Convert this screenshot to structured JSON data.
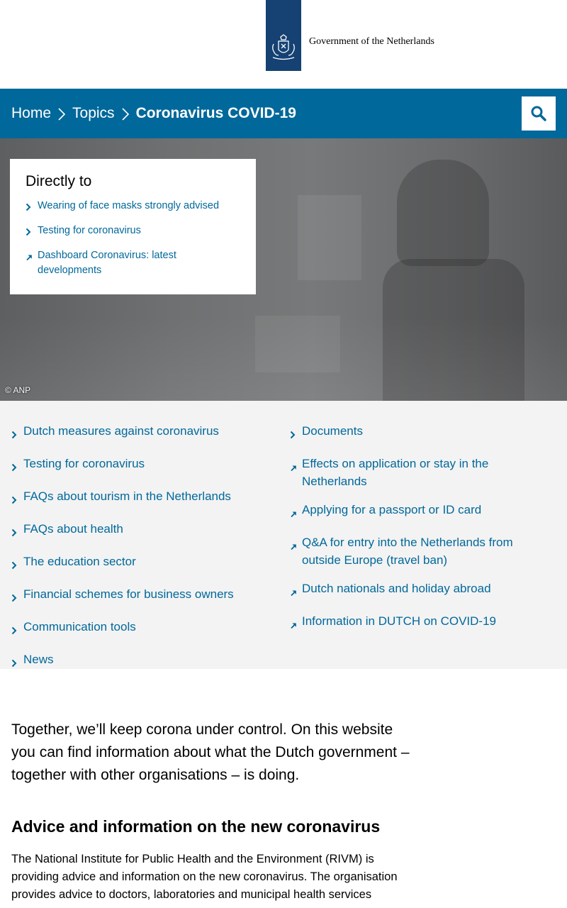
{
  "header": {
    "logo_text": "Government of the Netherlands"
  },
  "breadcrumb": {
    "items": [
      "Home",
      "Topics",
      "Coronavirus COVID-19"
    ]
  },
  "hero": {
    "credit": "© ANP",
    "directly_to": {
      "title": "Directly to",
      "links": [
        {
          "label": "Wearing of face masks strongly advised",
          "icon": "chevron-right-icon"
        },
        {
          "label": "Testing for coronavirus",
          "icon": "chevron-right-icon"
        },
        {
          "label": "Dashboard Coronavirus: latest developments",
          "icon": "external-link-icon"
        }
      ]
    }
  },
  "links": {
    "left": [
      "Dutch measures against coronavirus",
      "Testing for coronavirus",
      "FAQs about tourism in the Netherlands",
      "FAQs about health",
      "The education sector",
      "Financial schemes for business owners",
      "Communication tools",
      "News"
    ],
    "right": [
      {
        "label": "Documents",
        "icon": "chevron-right-icon"
      },
      {
        "label": "Effects on application or stay in the Netherlands",
        "icon": "external-link-icon"
      },
      {
        "label": "Applying for a passport or ID card",
        "icon": "external-link-icon"
      },
      {
        "label": "Q&A for entry into the Netherlands from outside Europe (travel ban)",
        "icon": "external-link-icon"
      },
      {
        "label": "Dutch nationals and holiday abroad",
        "icon": "external-link-icon"
      },
      {
        "label": "Information in DUTCH on COVID-19",
        "icon": "external-link-icon"
      }
    ]
  },
  "content": {
    "intro": "Together, we’ll keep corona under control. On this website you can find information about what the Dutch government – together with other organisations – is doing.",
    "section_heading": "Advice and information on the new coronavirus",
    "paragraph": "The National Institute for Public Health and the Environment (RIVM) is providing advice and information on the new coronavirus. The organisation provides advice to doctors, laboratories and municipal health services"
  },
  "colors": {
    "brand_blue": "#01689b",
    "logo_blue": "#154273",
    "link_bg": "#f3f3f3"
  }
}
